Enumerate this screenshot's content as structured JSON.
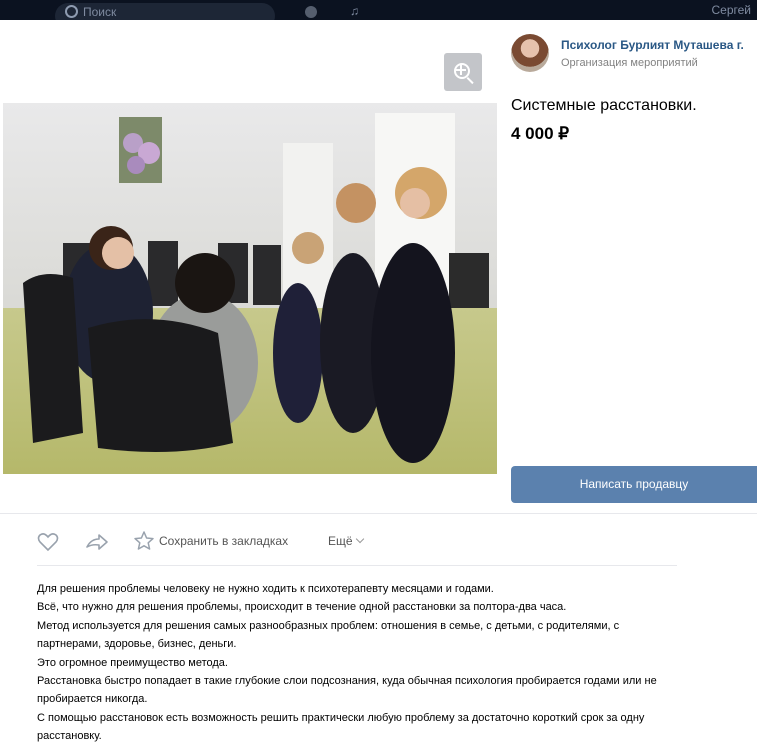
{
  "topbar": {
    "search_placeholder": "Поиск",
    "user_name": "Сергей"
  },
  "seller": {
    "name": "Психолог Бурлият Муташева г.",
    "type": "Организация мероприятий"
  },
  "product": {
    "title": "Системные расстановки.",
    "price": "4 000 ₽"
  },
  "buttons": {
    "contact_seller": "Написать продавцу"
  },
  "actions": {
    "save_label": "Сохранить в закладках",
    "more_label": "Ещё"
  },
  "description": [
    "Для решения проблемы человеку не нужно ходить к психотерапевту месяцами и годами.",
    "Всё, что нужно для решения проблемы, происходит в течение одной расстановки за полтора-два часа.",
    "Метод используется для решения самых разнообразных проблем: отношения в семье, с детьми, с родителями, с партнерами, здоровье, бизнес, деньги.",
    "Это огромное преимущество метода.",
    "Расстановка быстро попадает в такие глубокие слои подсознания, куда обычная психология пробирается годами или не пробирается никогда.",
    "С помощью расстановок есть возможность решить практически любую проблему за достаточно короткий срок за одну расстановку."
  ],
  "icons": {
    "zoom": "zoom-in-icon",
    "like": "heart-icon",
    "share": "share-arrow-icon",
    "bookmark": "star-icon"
  },
  "colors": {
    "link": "#2a5885",
    "button": "#5b81ae",
    "topbar": "#0b1220"
  }
}
